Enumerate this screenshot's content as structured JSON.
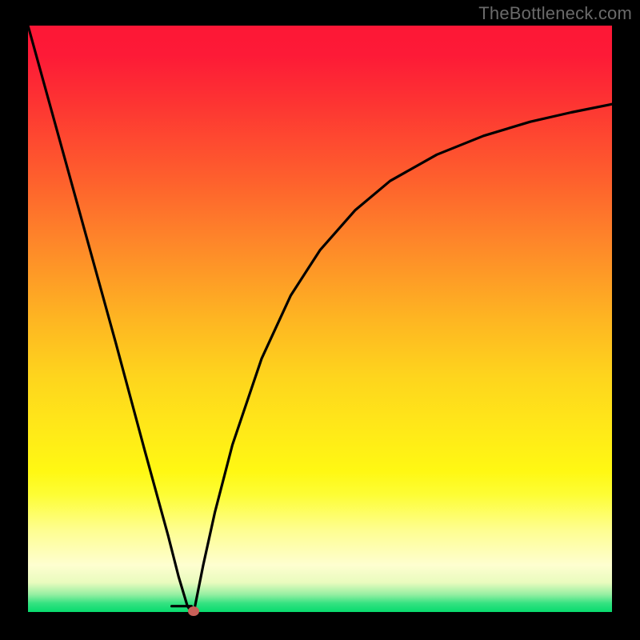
{
  "watermark": "TheBottleneck.com",
  "dot": {
    "x_frac": 0.284,
    "y_frac": 0.998
  },
  "chart_data": {
    "type": "line",
    "title": "",
    "xlabel": "",
    "ylabel": "",
    "xlim": [
      0,
      1
    ],
    "ylim": [
      0,
      1
    ],
    "series": [
      {
        "name": "left-branch",
        "x": [
          0.0,
          0.05,
          0.1,
          0.15,
          0.2,
          0.24,
          0.258,
          0.273,
          0.28
        ],
        "y": [
          1.0,
          0.82,
          0.64,
          0.46,
          0.275,
          0.13,
          0.06,
          0.01,
          0.0
        ]
      },
      {
        "name": "plateau",
        "x": [
          0.246,
          0.28
        ],
        "y": [
          0.01,
          0.01
        ]
      },
      {
        "name": "right-branch",
        "x": [
          0.284,
          0.3,
          0.32,
          0.35,
          0.4,
          0.45,
          0.5,
          0.56,
          0.62,
          0.7,
          0.78,
          0.86,
          0.93,
          1.0
        ],
        "y": [
          0.0,
          0.08,
          0.17,
          0.285,
          0.432,
          0.54,
          0.617,
          0.685,
          0.735,
          0.78,
          0.812,
          0.836,
          0.852,
          0.866
        ]
      }
    ],
    "marker": {
      "x": 0.284,
      "y": 0.002,
      "color": "#c86058"
    },
    "background_gradient": {
      "top": "#fd1736",
      "bottom": "#08db6e"
    }
  }
}
